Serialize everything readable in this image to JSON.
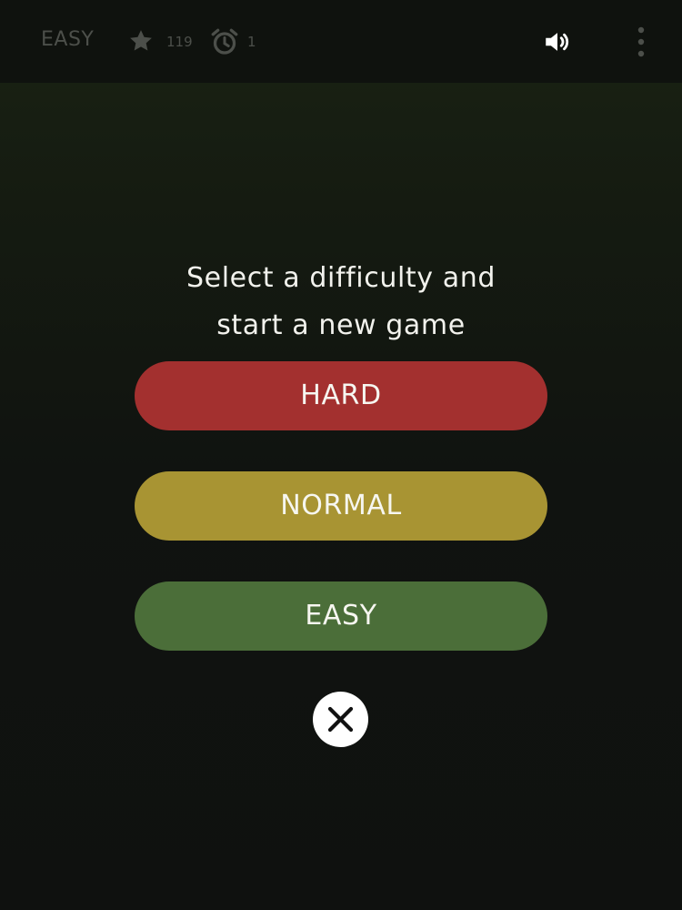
{
  "header": {
    "difficulty": "EASY",
    "score": "119",
    "timer": "1",
    "icons": {
      "score": "star-icon",
      "timer": "alarm-clock-icon",
      "sound": "speaker-icon",
      "menu": "more-vertical-icon"
    }
  },
  "dialog": {
    "prompt_line1": "Select a difficulty and",
    "prompt_line2": "start a new game",
    "buttons": [
      {
        "label": "HARD",
        "color": "#a3302f"
      },
      {
        "label": "NORMAL",
        "color": "#a89433"
      },
      {
        "label": "EASY",
        "color": "#4b6e39"
      }
    ],
    "close_icon": "close-icon"
  },
  "colors": {
    "background": "#121610",
    "header_background": "#0f120e",
    "muted_text": "#4c4f4a",
    "primary_text": "#f2f2ed"
  }
}
